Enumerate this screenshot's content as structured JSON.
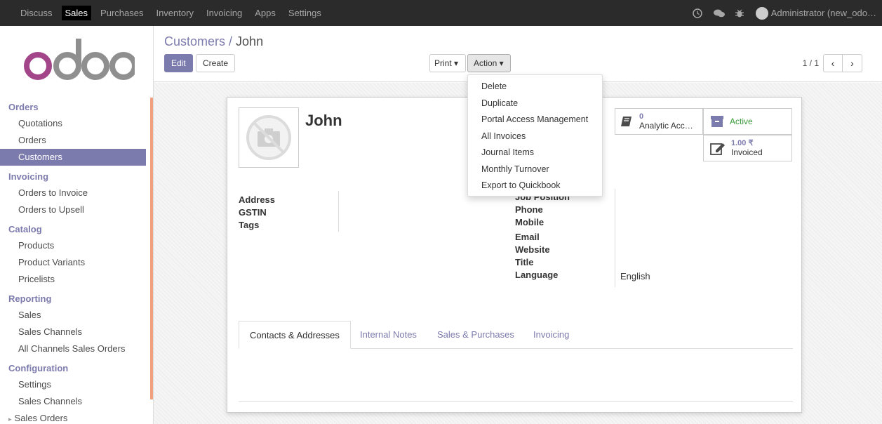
{
  "topbar": {
    "menu": [
      "Discuss",
      "Sales",
      "Purchases",
      "Inventory",
      "Invoicing",
      "Apps",
      "Settings"
    ],
    "active": "Sales",
    "user": "Administrator (new_odo…"
  },
  "logo": {
    "text": "odoo"
  },
  "sidebar": {
    "groups": [
      {
        "title": "Orders",
        "items": [
          "Quotations",
          "Orders",
          "Customers"
        ]
      },
      {
        "title": "Invoicing",
        "items": [
          "Orders to Invoice",
          "Orders to Upsell"
        ]
      },
      {
        "title": "Catalog",
        "items": [
          "Products",
          "Product Variants",
          "Pricelists"
        ]
      },
      {
        "title": "Reporting",
        "items": [
          "Sales",
          "Sales Channels",
          "All Channels Sales Orders"
        ]
      },
      {
        "title": "Configuration",
        "items": [
          "Settings",
          "Sales Channels",
          "Sales Orders"
        ]
      }
    ],
    "active_item": "Customers"
  },
  "breadcrumb": {
    "parent": "Customers",
    "sep": " / ",
    "current": "John"
  },
  "buttons": {
    "edit": "Edit",
    "create": "Create",
    "print": "Print ▾",
    "action": "Action ▾"
  },
  "pager": {
    "value": "1 / 1",
    "prev": "‹",
    "next": "›"
  },
  "action_menu": [
    "Delete",
    "Duplicate",
    "Portal Access Management",
    "All Invoices",
    "Journal Items",
    "Monthly Turnover",
    "Export to Quickbook"
  ],
  "record": {
    "name": "John",
    "stats": {
      "analytic_value": "0",
      "analytic_label": "Analytic Acc…",
      "active_label": "Active",
      "invoiced_value": "1.00 ₹",
      "invoiced_label": "Invoiced"
    },
    "left_fields": [
      "Address",
      "GSTIN",
      "Tags"
    ],
    "right_fields": [
      "Job Position",
      "Phone",
      "Mobile",
      "Email",
      "Website",
      "Title",
      "Language"
    ],
    "language_value": "English"
  },
  "tabs": [
    "Contacts & Addresses",
    "Internal Notes",
    "Sales & Purchases",
    "Invoicing"
  ],
  "colors": {
    "brand": "#7c7bad",
    "topbar": "#2b2b2b",
    "accent_scroll": "#f0a07c"
  }
}
